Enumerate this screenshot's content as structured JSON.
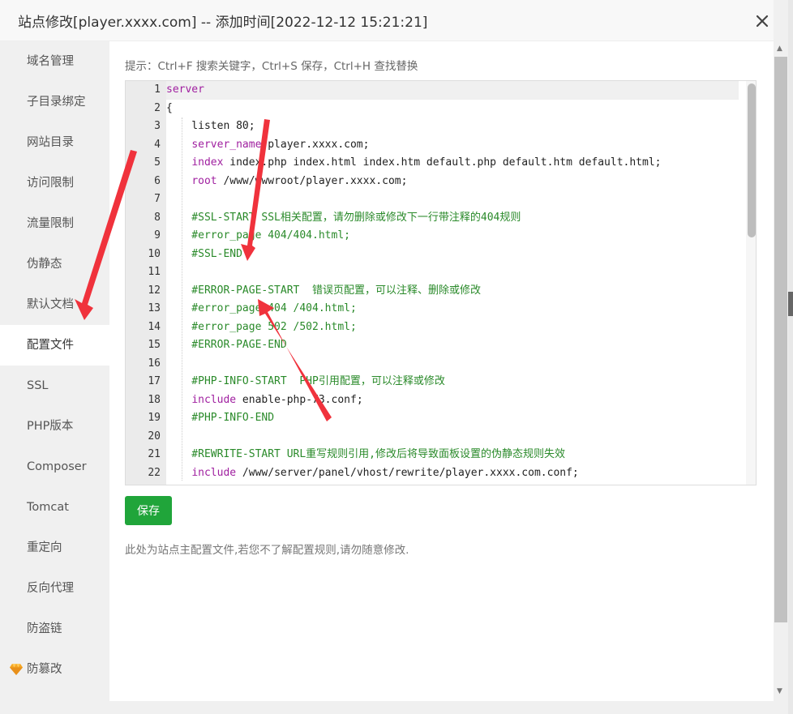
{
  "dialog": {
    "title": "站点修改[player.xxxx.com] -- 添加时间[2022-12-12 15:21:21]",
    "close_label": "×"
  },
  "sidebar": {
    "items": [
      {
        "label": "域名管理"
      },
      {
        "label": "子目录绑定"
      },
      {
        "label": "网站目录"
      },
      {
        "label": "访问限制"
      },
      {
        "label": "流量限制"
      },
      {
        "label": "伪静态"
      },
      {
        "label": "默认文档"
      },
      {
        "label": "配置文件",
        "active": true
      },
      {
        "label": "SSL"
      },
      {
        "label": "PHP版本"
      },
      {
        "label": "Composer"
      },
      {
        "label": "Tomcat"
      },
      {
        "label": "重定向"
      },
      {
        "label": "反向代理"
      },
      {
        "label": "防盗链"
      },
      {
        "label": "防篡改",
        "icon": "diamond-icon"
      }
    ]
  },
  "content": {
    "hint": "提示：Ctrl+F 搜索关键字，Ctrl+S 保存，Ctrl+H 查找替换",
    "save_label": "保存",
    "note": "此处为站点主配置文件,若您不了解配置规则,请勿随意修改."
  },
  "editor": {
    "lines": [
      {
        "n": "1",
        "parts": [
          {
            "t": "server",
            "c": "kw"
          }
        ]
      },
      {
        "n": "2",
        "parts": [
          {
            "t": "{",
            "c": "pl"
          }
        ]
      },
      {
        "n": "3",
        "parts": [
          {
            "t": "    listen 80;",
            "c": "pl"
          }
        ]
      },
      {
        "n": "4",
        "parts": [
          {
            "t": "    ",
            "c": "pl"
          },
          {
            "t": "server_name",
            "c": "kw"
          },
          {
            "t": " player.xxxx.com;",
            "c": "pl"
          }
        ]
      },
      {
        "n": "5",
        "parts": [
          {
            "t": "    ",
            "c": "pl"
          },
          {
            "t": "index",
            "c": "kw"
          },
          {
            "t": " index.php index.html index.htm default.php default.htm default.html;",
            "c": "pl"
          }
        ]
      },
      {
        "n": "6",
        "parts": [
          {
            "t": "    ",
            "c": "pl"
          },
          {
            "t": "root",
            "c": "kw"
          },
          {
            "t": " /www/wwwroot/player.xxxx.com;",
            "c": "pl"
          }
        ]
      },
      {
        "n": "7",
        "parts": []
      },
      {
        "n": "8",
        "parts": [
          {
            "t": "    #SSL-START SSL相关配置，请勿删除或修改下一行带注释的404规则",
            "c": "cm"
          }
        ]
      },
      {
        "n": "9",
        "parts": [
          {
            "t": "    #error_page 404/404.html;",
            "c": "cm"
          }
        ]
      },
      {
        "n": "10",
        "parts": [
          {
            "t": "    #SSL-END",
            "c": "cm"
          }
        ]
      },
      {
        "n": "11",
        "parts": []
      },
      {
        "n": "12",
        "parts": [
          {
            "t": "    #ERROR-PAGE-START  错误页配置，可以注释、删除或修改",
            "c": "cm"
          }
        ]
      },
      {
        "n": "13",
        "parts": [
          {
            "t": "    #error_page 404 /404.html;",
            "c": "cm"
          }
        ]
      },
      {
        "n": "14",
        "parts": [
          {
            "t": "    #error_page 502 /502.html;",
            "c": "cm"
          }
        ]
      },
      {
        "n": "15",
        "parts": [
          {
            "t": "    #ERROR-PAGE-END",
            "c": "cm"
          }
        ]
      },
      {
        "n": "16",
        "parts": []
      },
      {
        "n": "17",
        "parts": [
          {
            "t": "    #PHP-INFO-START  PHP引用配置，可以注释或修改",
            "c": "cm"
          }
        ]
      },
      {
        "n": "18",
        "parts": [
          {
            "t": "    ",
            "c": "pl"
          },
          {
            "t": "include",
            "c": "kw"
          },
          {
            "t": " enable-php-73.conf;",
            "c": "pl"
          }
        ]
      },
      {
        "n": "19",
        "parts": [
          {
            "t": "    #PHP-INFO-END",
            "c": "cm"
          }
        ]
      },
      {
        "n": "20",
        "parts": []
      },
      {
        "n": "21",
        "parts": [
          {
            "t": "    #REWRITE-START URL重写规则引用,修改后将导致面板设置的伪静态规则失效",
            "c": "cm"
          }
        ]
      },
      {
        "n": "22",
        "parts": [
          {
            "t": "    ",
            "c": "pl"
          },
          {
            "t": "include",
            "c": "kw"
          },
          {
            "t": " /www/server/panel/vhost/rewrite/player.xxxx.com.conf;",
            "c": "pl"
          }
        ]
      }
    ]
  },
  "colors": {
    "accent_green": "#20a53a",
    "keyword": "#a020a0",
    "comment": "#2a8a2a",
    "arrow_red": "#f0323c"
  }
}
